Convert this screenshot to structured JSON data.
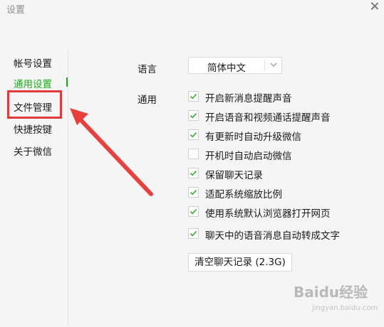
{
  "window": {
    "title": "设置"
  },
  "sidebar": {
    "items": [
      {
        "label": "帐号设置"
      },
      {
        "label": "通用设置"
      },
      {
        "label": "文件管理"
      },
      {
        "label": "快捷按键"
      },
      {
        "label": "关于微信"
      }
    ],
    "active_index": 1
  },
  "general": {
    "language_label": "语言",
    "language_value": "简体中文",
    "general_label": "通用",
    "options": [
      {
        "label": "开启新消息提醒声音",
        "checked": true
      },
      {
        "label": "开启语音和视频通话提醒声音",
        "checked": true
      },
      {
        "label": "有更新时自动升级微信",
        "checked": true
      },
      {
        "label": "开机时自动启动微信",
        "checked": false
      },
      {
        "label": "保留聊天记录",
        "checked": true
      },
      {
        "label": "适配系统缩放比例",
        "checked": true
      },
      {
        "label": "使用系统默认浏览器打开网页",
        "checked": true
      },
      {
        "label": "聊天中的语音消息自动转成文字",
        "checked": true
      }
    ],
    "clear_button_label": "清空聊天记录 (2.3G)"
  },
  "watermark": {
    "text": "Baidu经验",
    "sub": "jingyan.baidu.com"
  },
  "colors": {
    "accent": "#1aad19",
    "highlight": "#e33b3b",
    "checkmark": "#1aad19"
  }
}
